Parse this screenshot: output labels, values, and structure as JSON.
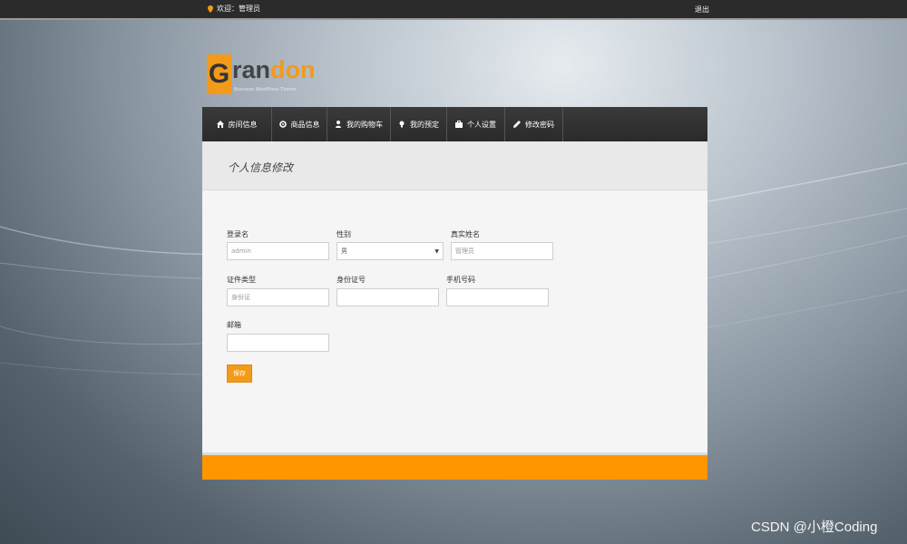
{
  "topbar": {
    "welcome": "欢迎：管理员",
    "logout": "退出"
  },
  "logo": {
    "letter": "G",
    "rest": "randon",
    "tagline": "Business WordPress Theme",
    "accent": "#f39a1a"
  },
  "nav": {
    "items": [
      {
        "label": "房间信息",
        "icon": "home-icon"
      },
      {
        "label": "商品信息",
        "icon": "gear-icon"
      },
      {
        "label": "我的购物车",
        "icon": "user-icon"
      },
      {
        "label": "我的预定",
        "icon": "bulb-icon"
      },
      {
        "label": "个人设置",
        "icon": "briefcase-icon"
      },
      {
        "label": "修改密码",
        "icon": "pencil-icon"
      }
    ]
  },
  "form": {
    "heading": "个人信息修改",
    "login_label": "登录名",
    "login_value": "admin",
    "gender_label": "性别",
    "gender_value": "男",
    "realname_label": "真实姓名",
    "realname_value": "管理员",
    "idtype_label": "证件类型",
    "idtype_value": "身份证",
    "idnumber_label": "身份证号",
    "idnumber_value": "",
    "phone_label": "手机号码",
    "phone_value": "",
    "email_label": "邮箱",
    "email_value": "",
    "submit_label": "保存"
  },
  "footer_color": "#ff9600",
  "watermark": "CSDN @小橙Coding"
}
